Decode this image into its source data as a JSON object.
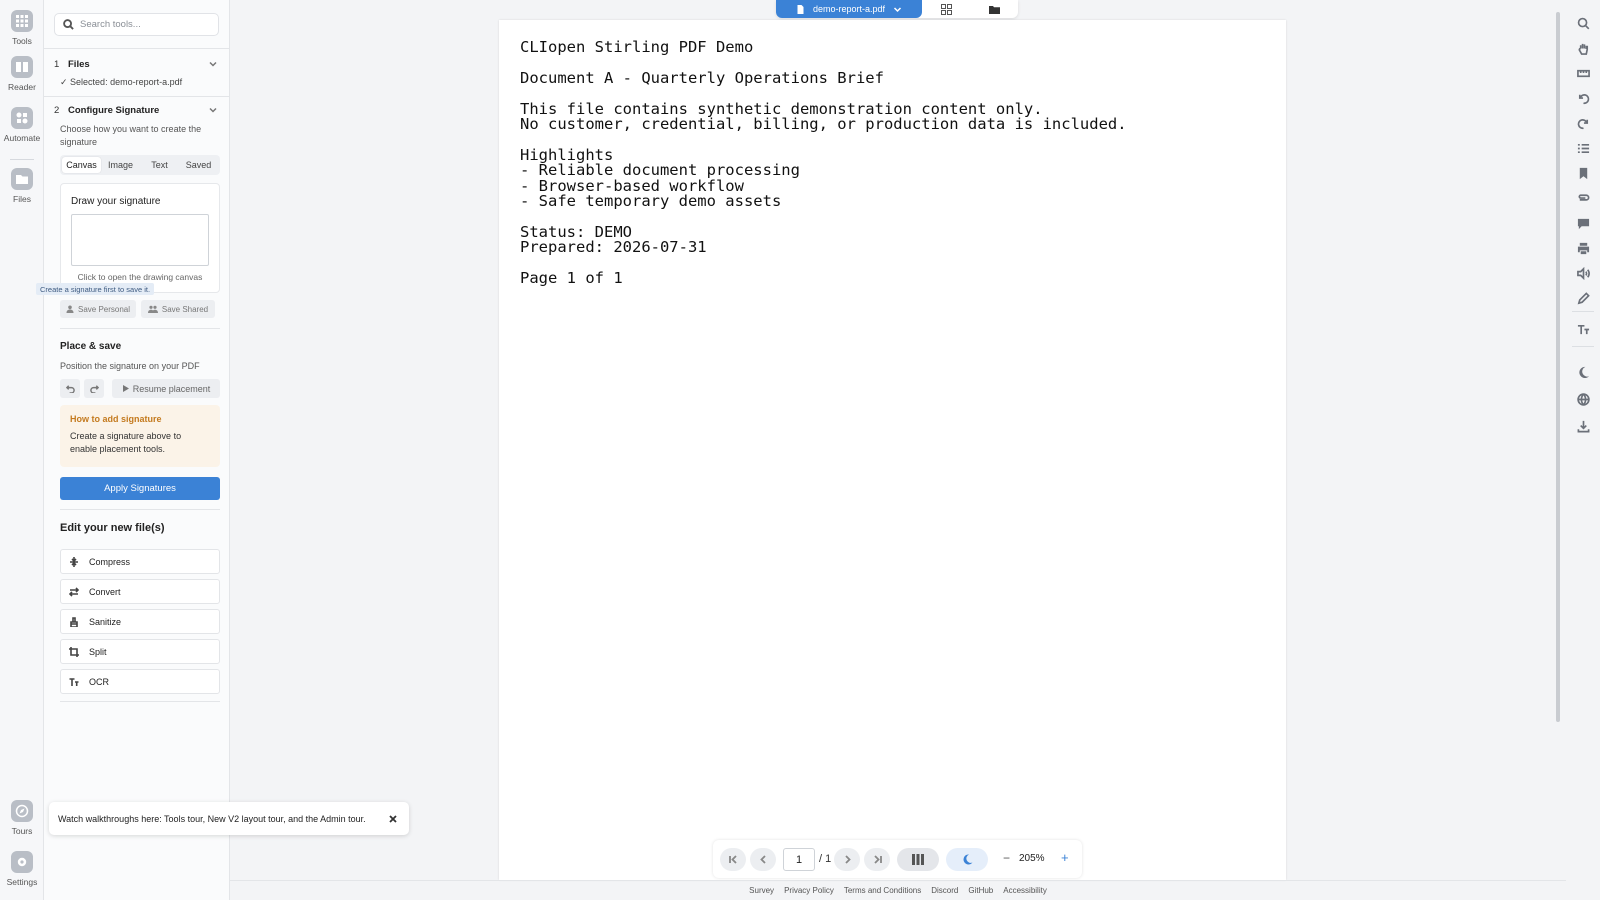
{
  "rail": {
    "items": [
      {
        "label": "Tools",
        "icon": "grid-icon"
      },
      {
        "label": "Reader",
        "icon": "book-icon"
      },
      {
        "label": "Automate",
        "icon": "automate-icon"
      },
      {
        "label": "Files",
        "icon": "folder-icon"
      },
      {
        "label": "Tours",
        "icon": "compass-icon"
      },
      {
        "label": "Settings",
        "icon": "gear-icon"
      }
    ]
  },
  "search": {
    "placeholder": "Search tools..."
  },
  "steps": [
    {
      "num": "1",
      "title": "Files"
    },
    {
      "num": "2",
      "title": "Configure Signature"
    }
  ],
  "files": {
    "selected": "✓ Selected: demo-report-a.pdf"
  },
  "config": {
    "description": "Choose how you want to create the signature"
  },
  "tabs": [
    {
      "label": "Canvas",
      "active": true
    },
    {
      "label": "Image"
    },
    {
      "label": "Text"
    },
    {
      "label": "Saved"
    }
  ],
  "draw": {
    "title": "Draw your signature",
    "hint": "Click to open the drawing canvas",
    "tooltip": "Create a signature first to save it.",
    "save_personal": "Save Personal",
    "save_shared": "Save Shared"
  },
  "place": {
    "title": "Place & save",
    "description": "Position the signature on your PDF",
    "resume": "Resume placement"
  },
  "how": {
    "title": "How to add signature",
    "text": "Create a signature above to enable placement tools."
  },
  "apply": {
    "label": "Apply Signatures"
  },
  "edit": {
    "title": "Edit your new file(s)",
    "items": [
      {
        "label": "Compress",
        "icon": "compress-icon"
      },
      {
        "label": "Convert",
        "icon": "convert-icon"
      },
      {
        "label": "Sanitize",
        "icon": "sanitize-icon"
      },
      {
        "label": "Split",
        "icon": "crop-icon"
      },
      {
        "label": "OCR",
        "icon": "text-size-icon"
      }
    ]
  },
  "toast": {
    "text": "Watch walkthroughs here: Tools tour, New V2 layout tour, and the Admin tour."
  },
  "viewer": {
    "file_name": "demo-report-a.pdf",
    "content": "CLIopen Stirling PDF Demo\n\nDocument A - Quarterly Operations Brief\n\nThis file contains synthetic demonstration content only.\nNo customer, credential, billing, or production data is included.\n\nHighlights\n- Reliable document processing\n- Browser-based workflow\n- Safe temporary demo assets\n\nStatus: DEMO\nPrepared: 2026-07-31\n\nPage 1 of 1"
  },
  "nav": {
    "page": "1",
    "total": "/ 1",
    "zoom": "205%",
    "minus": "−",
    "plus": "+"
  },
  "footer": {
    "links": [
      "Survey",
      "Privacy Policy",
      "Terms and Conditions",
      "Discord",
      "GitHub",
      "Accessibility"
    ]
  },
  "colors": {
    "accent": "#3b82d6",
    "warning_title": "#c47a1e",
    "warning_bg": "#fbf3e8"
  }
}
